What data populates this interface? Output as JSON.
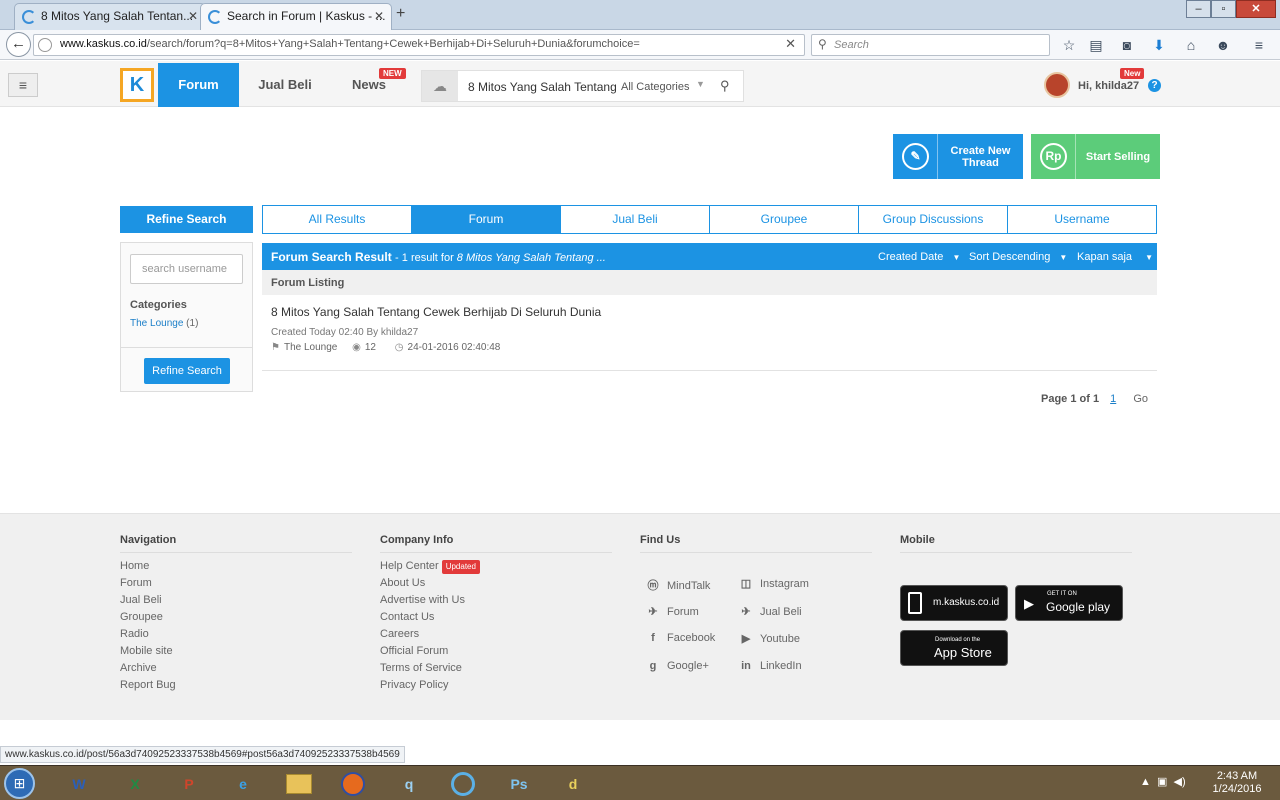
{
  "browser": {
    "tabs": [
      {
        "label": "8 Mitos Yang Salah Tentan...",
        "active": false
      },
      {
        "label": "Search in Forum | Kaskus - ...",
        "active": true
      }
    ],
    "url_domain": "www.kaskus.co.id",
    "url_path": "/search/forum?q=8+Mitos+Yang+Salah+Tentang+Cewek+Berhijab+Di+Seluruh+Dunia&forumchoice=",
    "search_placeholder": "Search"
  },
  "header": {
    "logo": "K",
    "tabs": [
      "Forum",
      "Jual Beli",
      "News"
    ],
    "news_badge": "NEW",
    "search_query": "8 Mitos Yang Salah Tentang",
    "category": "All Categories",
    "greeting": "Hi, khilda27",
    "user_badge": "New",
    "help": "?"
  },
  "actions": {
    "create_thread": "Create New Thread",
    "start_selling": "Start Selling",
    "rp_label": "Rp"
  },
  "search_tabs": {
    "refine_heading": "Refine Search",
    "tabs": [
      "All Results",
      "Forum",
      "Jual Beli",
      "Groupee",
      "Group Discussions",
      "Username"
    ],
    "active": "Forum"
  },
  "sidebar": {
    "username_placeholder": "search username",
    "categories_heading": "Categories",
    "category_link": "The Lounge",
    "category_count": "(1)",
    "refine_button": "Refine Search"
  },
  "results": {
    "title": "Forum Search Result",
    "summary": "- 1 result for ",
    "query": "8 Mitos Yang Salah Tentang ...",
    "sort_field": "Created Date",
    "sort_order": "Sort Descending",
    "time_filter": "Kapan saja",
    "listing_heading": "Forum Listing",
    "item": {
      "title": "8 Mitos Yang Salah Tentang Cewek Berhijab Di Seluruh Dunia",
      "created": "Created Today 02:40 By khilda27",
      "forum": "The Lounge",
      "views": "12",
      "datetime": "24-01-2016 02:40:48"
    },
    "pagination": {
      "label": "Page 1 of 1",
      "current": "1",
      "go": "Go"
    }
  },
  "footer": {
    "navigation": {
      "heading": "Navigation",
      "links": [
        "Home",
        "Forum",
        "Jual Beli",
        "Groupee",
        "Radio",
        "Mobile site",
        "Archive",
        "Report Bug"
      ]
    },
    "company": {
      "heading": "Company Info",
      "links": [
        "Help Center",
        "About Us",
        "Advertise with Us",
        "Contact Us",
        "Careers",
        "Official Forum",
        "Terms of Service",
        "Privacy Policy"
      ],
      "updated_badge": "Updated"
    },
    "find_us": {
      "heading": "Find Us",
      "links": [
        "MindTalk",
        "Instagram",
        "Forum",
        "Jual Beli",
        "Facebook",
        "Youtube",
        "Google+",
        "LinkedIn"
      ]
    },
    "mobile": {
      "heading": "Mobile",
      "site": "m.kaskus.co.id",
      "gplay_small": "GET IT ON",
      "gplay_big": "Google play",
      "appstore_small": "Download on the",
      "appstore_big": "App Store"
    }
  },
  "status_url": "www.kaskus.co.id/post/56a3d74092523337538b4569#post56a3d74092523337538b4569",
  "taskbar": {
    "time": "2:43 AM",
    "date": "1/24/2016",
    "apps": [
      "W",
      "X",
      "P",
      "e",
      "folder",
      "firefox",
      "q",
      "o",
      "Ps",
      "d"
    ]
  },
  "colors": {
    "primary": "#1c93e3",
    "sell": "#5ccc7a",
    "badge": "#e23a3a"
  }
}
